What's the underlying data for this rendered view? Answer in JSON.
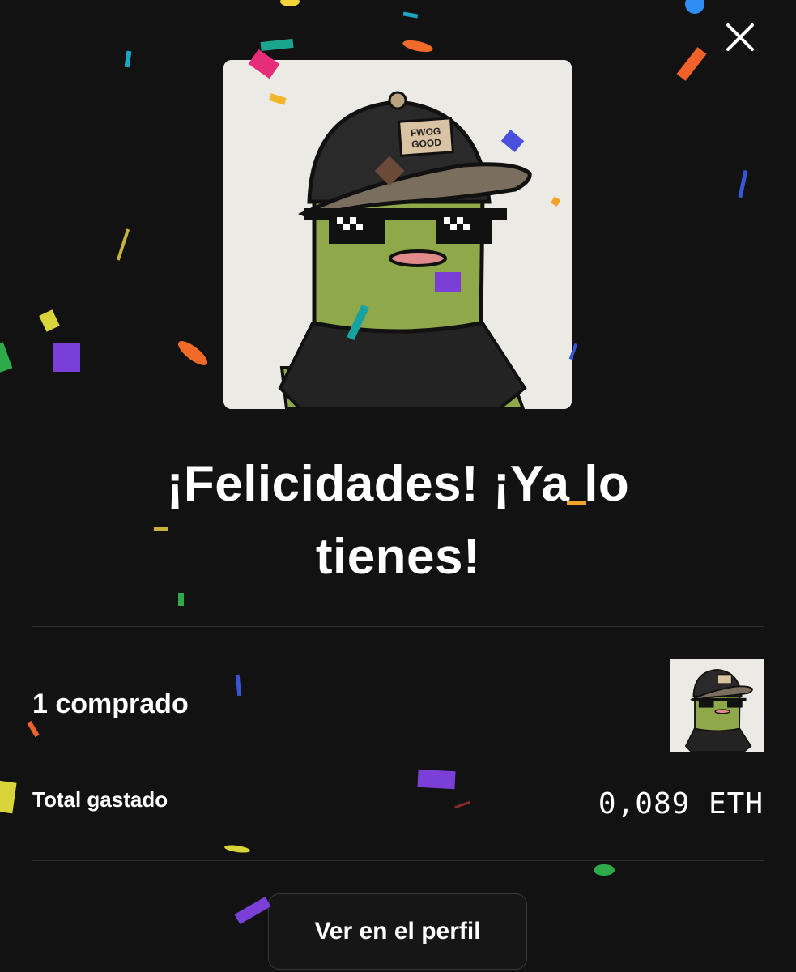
{
  "modal": {
    "close_icon": "close-icon",
    "headline": "¡Felicidades! ¡Ya lo tienes!"
  },
  "nft": {
    "cap_patch_line1": "FWOG",
    "cap_patch_line2": "GOOD"
  },
  "summary": {
    "purchased_label": "1 comprado",
    "total_label": "Total gastado",
    "total_value": "0,089 ETH"
  },
  "actions": {
    "view_profile_label": "Ver en el perfil"
  },
  "colors": {
    "background": "#121212",
    "text": "#ffffff",
    "card_background": "#eceae5",
    "frog_green": "#8fa84a",
    "divider": "#2e2e2e"
  }
}
